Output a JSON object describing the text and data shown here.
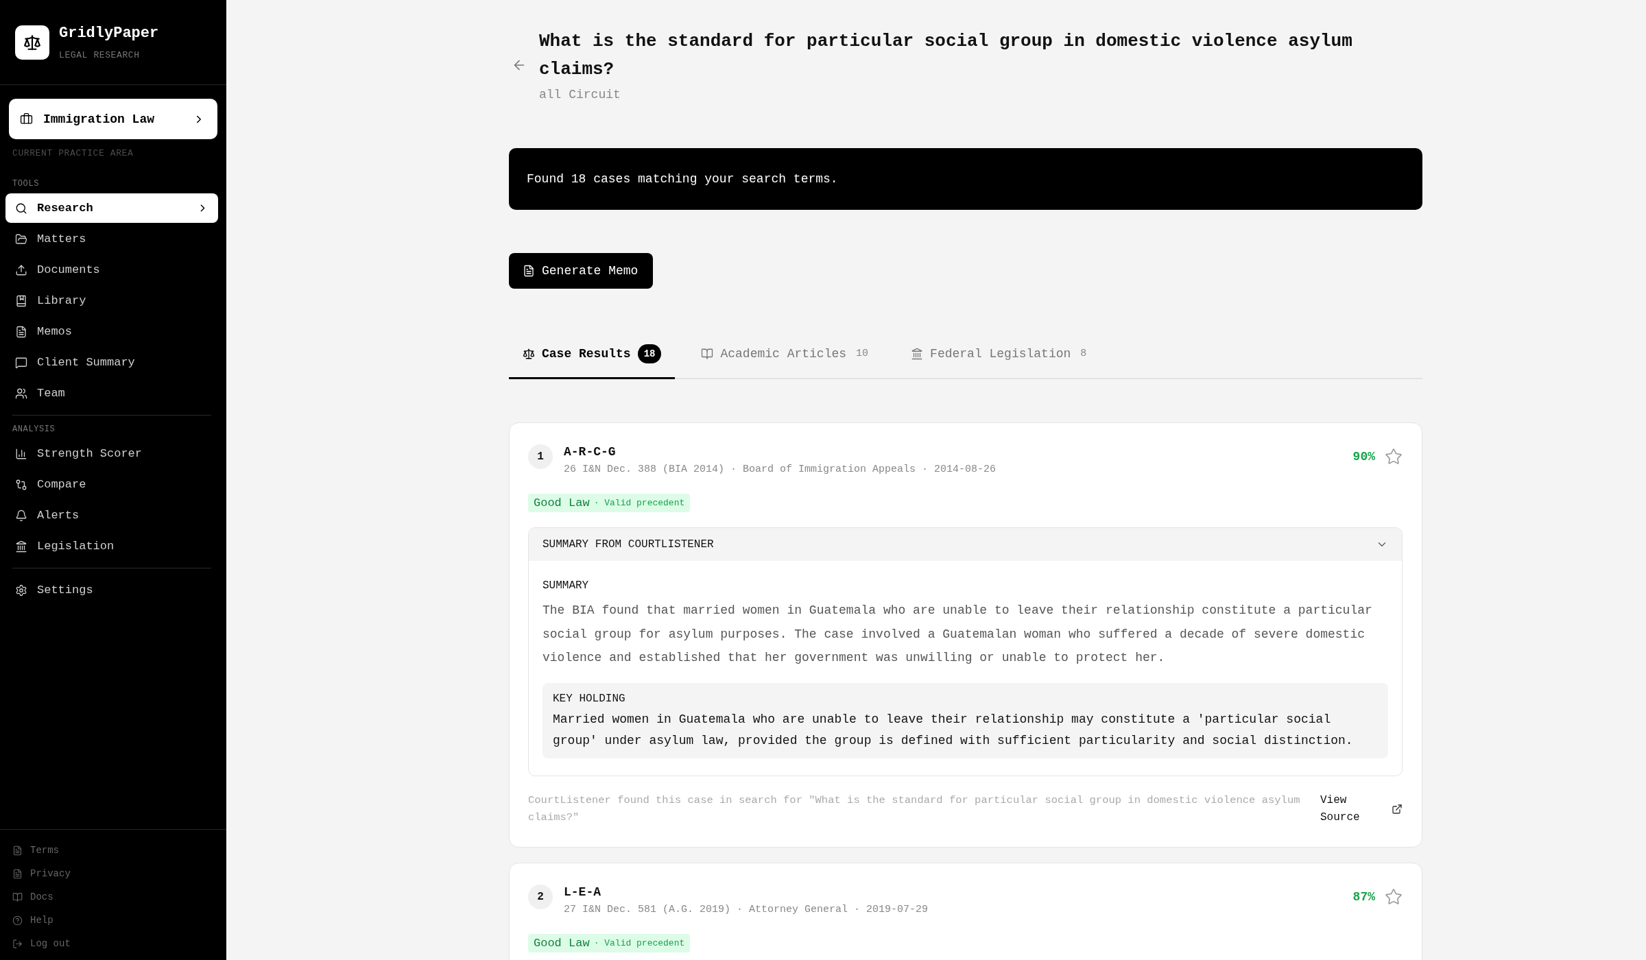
{
  "sidebar": {
    "brand": {
      "name": "GridlyPaper",
      "tagline": "LEGAL RESEARCH"
    },
    "practice_area": {
      "label": "Immigration Law",
      "caption": "CURRENT PRACTICE AREA"
    },
    "sections": [
      {
        "heading": "TOOLS",
        "items": [
          {
            "label": "Research",
            "selected": true
          },
          {
            "label": "Matters",
            "selected": false
          },
          {
            "label": "Documents",
            "selected": false
          },
          {
            "label": "Library",
            "selected": false
          },
          {
            "label": "Memos",
            "selected": false
          },
          {
            "label": "Client Summary",
            "selected": false
          },
          {
            "label": "Team",
            "selected": false
          }
        ]
      },
      {
        "heading": "ANALYSIS",
        "items": [
          {
            "label": "Strength Scorer",
            "selected": false
          },
          {
            "label": "Compare",
            "selected": false
          },
          {
            "label": "Alerts",
            "selected": false
          },
          {
            "label": "Legislation",
            "selected": false
          }
        ]
      },
      {
        "items": [
          {
            "label": "Settings",
            "selected": false
          }
        ]
      }
    ],
    "footer_links": [
      "Terms",
      "Privacy",
      "Docs",
      "Help",
      "Log out"
    ]
  },
  "header": {
    "title": "What is the standard for particular social group in domestic violence asylum claims?",
    "subtitle": "all Circuit"
  },
  "notice": "Found 18 cases matching your search terms.",
  "actions": [
    "Generate Memo"
  ],
  "tabs": [
    {
      "label": "Case Results",
      "count": "18",
      "selected": true
    },
    {
      "label": "Academic Articles",
      "count": "10",
      "selected": false
    },
    {
      "label": "Federal Legislation",
      "count": "8",
      "selected": false
    }
  ],
  "cases": [
    {
      "rank": "1",
      "name": "A-R-C-G",
      "meta": "26 I&N Dec. 388 (BIA 2014) · Board of Immigration Appeals · 2014-08-26",
      "score": "90%",
      "starred": false,
      "status": {
        "label": "Good Law",
        "note": "· Valid precedent"
      },
      "summary_panel": {
        "heading": "SUMMARY FROM COURTLISTENER",
        "expanded": true,
        "summary_label": "SUMMARY",
        "summary": "The BIA found that married women in Guatemala who are unable to leave their relationship constitute a particular social group for asylum purposes. The case involved a Guatemalan woman who suffered a decade of severe domestic violence and established that her government was unwilling or unable to protect her.",
        "holding_label": "KEY HOLDING",
        "holding": "Married women in Guatemala who are unable to leave their relationship may constitute a 'particular social group' under asylum law, provided the group is defined with sufficient particularity and social distinction."
      },
      "source_note": "CourtListener found this case in search for \"What is the standard for particular social group in domestic violence asylum claims?\"",
      "source_link": "View Source"
    },
    {
      "rank": "2",
      "name": "L-E-A",
      "meta": "27 I&N Dec. 581 (A.G. 2019) · Attorney General · 2019-07-29",
      "score": "87%",
      "starred": false,
      "status": {
        "label": "Good Law",
        "note": "· Valid precedent"
      }
    }
  ]
}
